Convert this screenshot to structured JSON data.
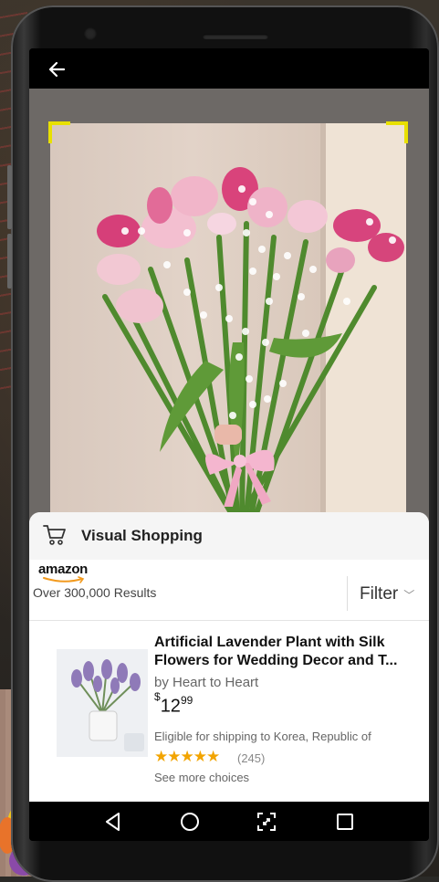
{
  "screen": {
    "sheet": {
      "title": "Visual Shopping",
      "brand": "amazon",
      "results_text": "Over 300,000 Results",
      "filter_label": "Filter"
    },
    "product": {
      "title": "Artificial Lavender Plant with Silk Flowers for Wedding Decor and T...",
      "by": "by Heart to Heart",
      "price_symbol": "$",
      "price_whole": "12",
      "price_cents": "99",
      "shipping": "Eligible for shipping to Korea, Republic of",
      "stars": "★★★★★",
      "rating": 5,
      "review_count": "(245)",
      "more_choices": "See more choices"
    },
    "icons": {
      "back": "back-arrow-icon",
      "cart": "shopping-cart-icon",
      "nav": [
        "back-triangle-icon",
        "home-circle-icon",
        "screen-capture-icon",
        "recents-square-icon"
      ]
    }
  },
  "colors": {
    "scan_corner": "#e8e000",
    "star": "#f2a400",
    "sheet_header_bg": "#f5f5f5"
  }
}
